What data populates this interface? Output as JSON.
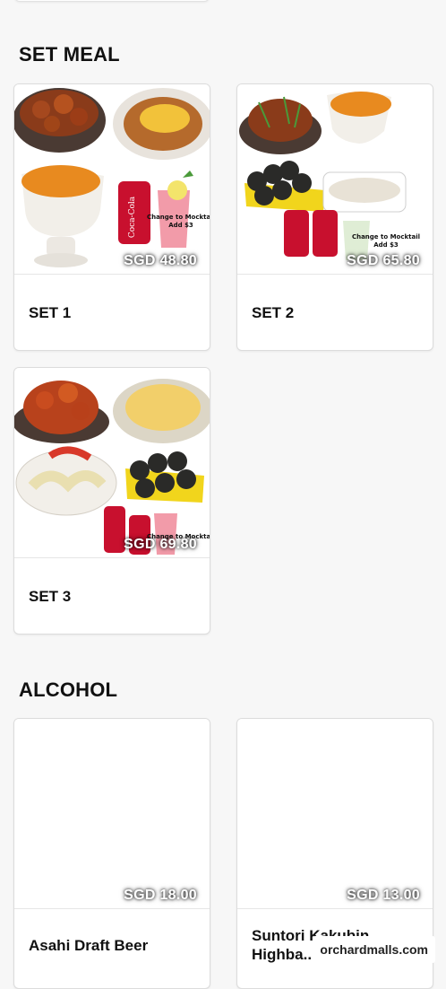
{
  "sections": {
    "set_meal": {
      "title": "SET MEAL",
      "items": [
        {
          "name": "SET 1",
          "price": "SGD 48.80",
          "promo": [
            "Change to Mocktail",
            "Add $3"
          ]
        },
        {
          "name": "SET 2",
          "price": "SGD 65.80",
          "promo": [
            "Change to Mocktail",
            "Add $3"
          ]
        },
        {
          "name": "SET 3",
          "price": "SGD 69.80",
          "promo": [
            "Change to Mocktail"
          ]
        }
      ]
    },
    "alcohol": {
      "title": "ALCOHOL",
      "items": [
        {
          "name": "Asahi Draft Beer",
          "price": "SGD 18.00"
        },
        {
          "name": "Suntori Kakubin Highba...",
          "price": "SGD 13.00"
        }
      ]
    }
  },
  "watermark": "orchardmalls.com",
  "colors": {
    "background": "#f7f7f7",
    "card": "#ffffff",
    "border": "#dcdcdc",
    "coke_red": "#c8102e"
  }
}
